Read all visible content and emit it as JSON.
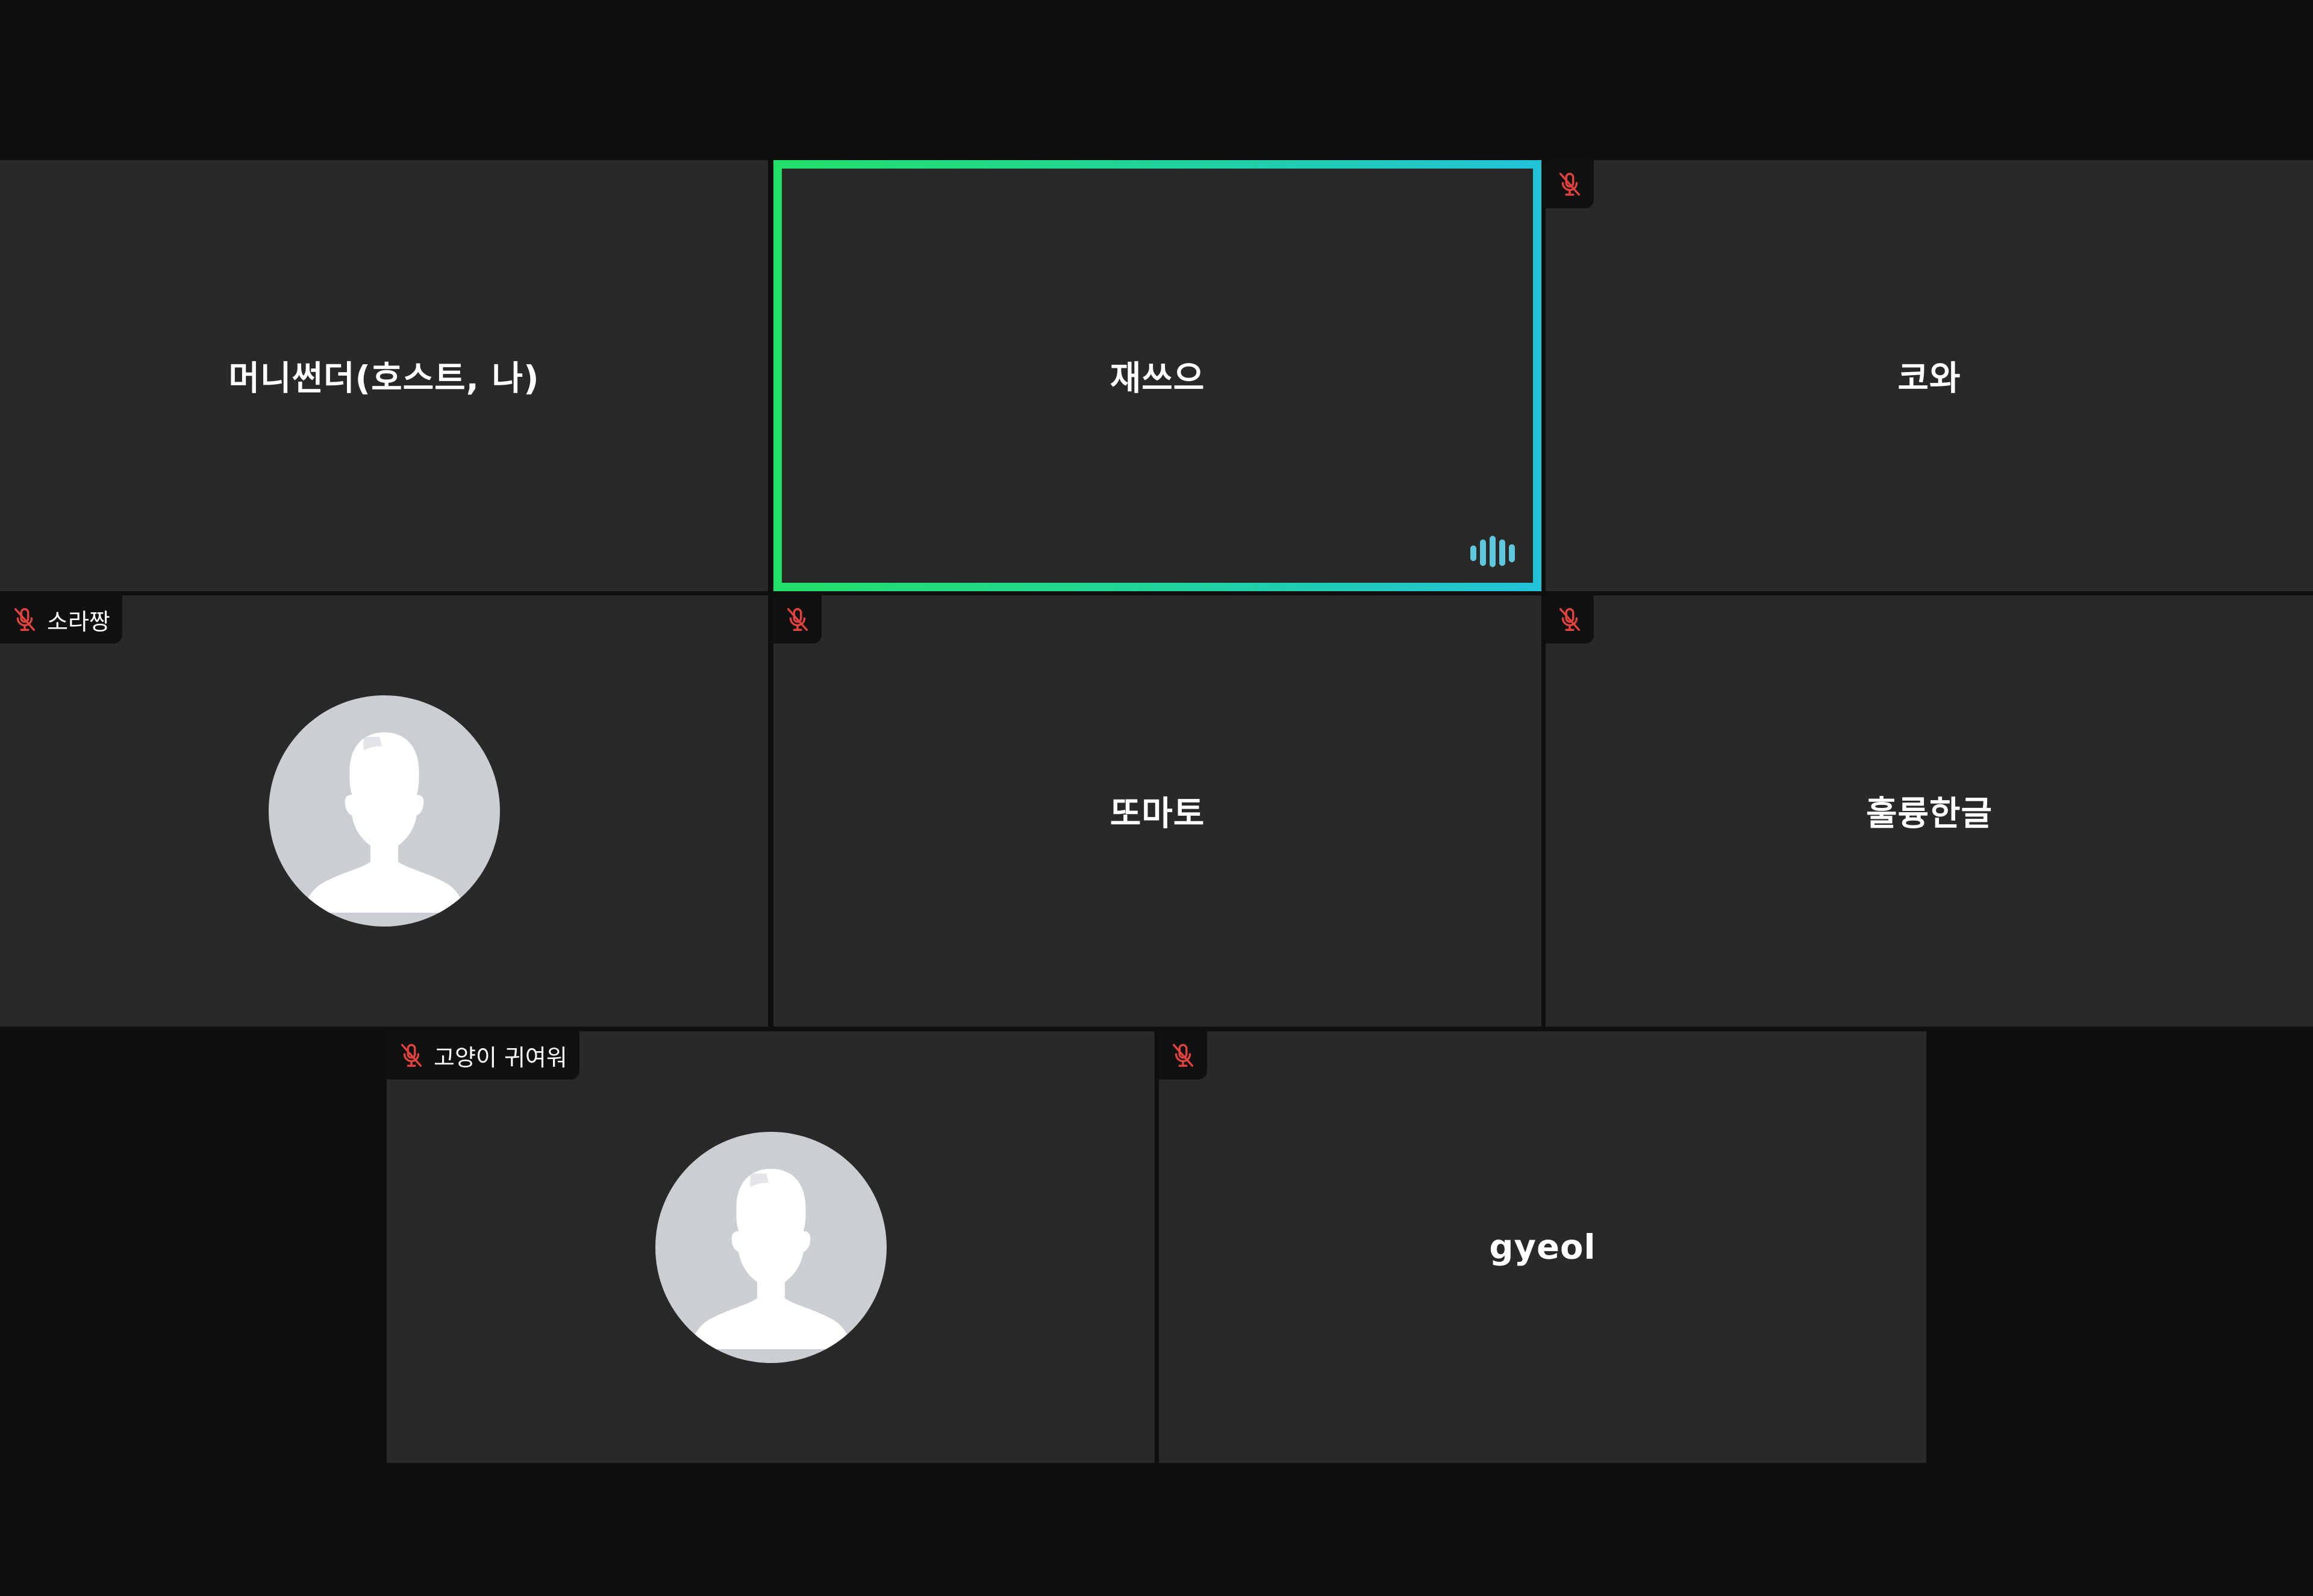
{
  "meeting": {
    "participants": [
      {
        "id": "p1",
        "name": "머니썬더(호스트, 나)",
        "muted": false,
        "speaking": false,
        "has_avatar": false
      },
      {
        "id": "p2",
        "name": "재쓰으",
        "muted": false,
        "speaking": true,
        "has_avatar": false
      },
      {
        "id": "p3",
        "name": "코와",
        "muted": true,
        "speaking": false,
        "has_avatar": false
      },
      {
        "id": "p4",
        "name": "소라짱",
        "muted": true,
        "speaking": false,
        "has_avatar": true
      },
      {
        "id": "p5",
        "name": "또마토",
        "muted": true,
        "speaking": false,
        "has_avatar": false
      },
      {
        "id": "p6",
        "name": "훌륭한글",
        "muted": true,
        "speaking": false,
        "has_avatar": false
      },
      {
        "id": "p7",
        "name": "고양이 귀여워",
        "muted": true,
        "speaking": false,
        "has_avatar": true
      },
      {
        "id": "p8",
        "name": "gyeol",
        "muted": true,
        "speaking": false,
        "has_avatar": false
      }
    ]
  },
  "icons": {
    "muted_mic": "mic-off-icon",
    "speaking_indicator": "audio-level-icon",
    "default_avatar": "user-silhouette-icon"
  },
  "colors": {
    "background": "#0f0f0f",
    "tile": "#292929",
    "muted_icon": "#e0423e",
    "speaking_border_start": "#21e06a",
    "speaking_border_end": "#22c2d8",
    "speaking_indicator": "#5ec7de",
    "avatar_bg": "#cbced3"
  }
}
